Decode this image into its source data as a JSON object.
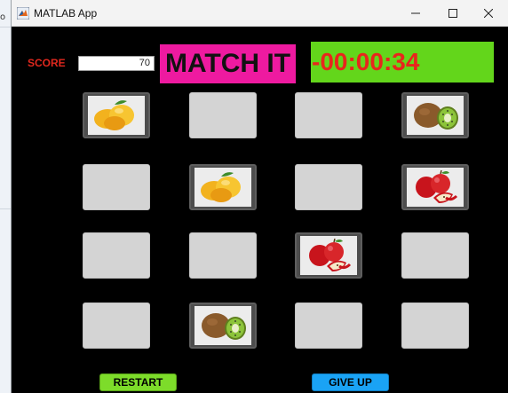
{
  "background_app": {
    "fragment_text": "o"
  },
  "window": {
    "title": "MATLAB App",
    "controls": {
      "minimize": "—",
      "maximize": "☐",
      "close": "✕"
    }
  },
  "game": {
    "score_label": "SCORE",
    "score_value": "70",
    "title": "MATCH IT",
    "timer": "-00:00:34"
  },
  "cards": [
    {
      "state": "revealed",
      "fruit": "mango"
    },
    {
      "state": "hidden",
      "fruit": ""
    },
    {
      "state": "hidden",
      "fruit": ""
    },
    {
      "state": "revealed",
      "fruit": "kiwi"
    },
    {
      "state": "hidden",
      "fruit": ""
    },
    {
      "state": "revealed",
      "fruit": "mango"
    },
    {
      "state": "hidden",
      "fruit": ""
    },
    {
      "state": "revealed",
      "fruit": "apple"
    },
    {
      "state": "hidden",
      "fruit": ""
    },
    {
      "state": "hidden",
      "fruit": ""
    },
    {
      "state": "revealed",
      "fruit": "apple"
    },
    {
      "state": "hidden",
      "fruit": ""
    },
    {
      "state": "hidden",
      "fruit": ""
    },
    {
      "state": "revealed",
      "fruit": "kiwi"
    },
    {
      "state": "hidden",
      "fruit": ""
    },
    {
      "state": "hidden",
      "fruit": ""
    }
  ],
  "buttons": {
    "restart": "RESTART",
    "give_up": "GIVE UP"
  },
  "colors": {
    "score_label": "#e0281e",
    "title_bg": "#ee1aa0",
    "timer_bg": "#63d61b",
    "timer_text": "#e8261c",
    "restart_bg": "#7ddc2a",
    "giveup_bg": "#1aa3f5",
    "card_hidden": "#d4d4d4"
  }
}
